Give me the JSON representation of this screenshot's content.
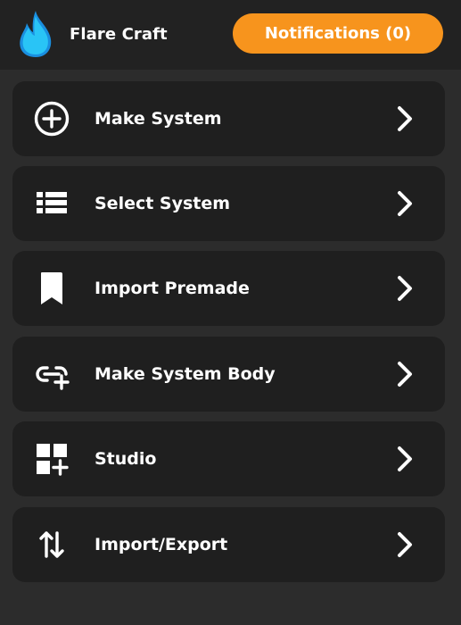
{
  "app": {
    "name": "Flare Craft"
  },
  "header": {
    "notifications_label": "Notifications (0)"
  },
  "colors": {
    "accent": "#f7941d",
    "flame": "#29c4f6",
    "card": "#1f1f1f",
    "background": "#2c2c2c",
    "topbar": "#222222"
  },
  "menu": {
    "items": [
      {
        "label": "Make System",
        "icon": "plus-circle-icon"
      },
      {
        "label": "Select System",
        "icon": "list-icon"
      },
      {
        "label": "Import Premade",
        "icon": "bookmark-icon"
      },
      {
        "label": "Make System Body",
        "icon": "link-add-icon"
      },
      {
        "label": "Studio",
        "icon": "dashboard-add-icon"
      },
      {
        "label": "Import/Export",
        "icon": "swap-vertical-icon"
      }
    ]
  }
}
